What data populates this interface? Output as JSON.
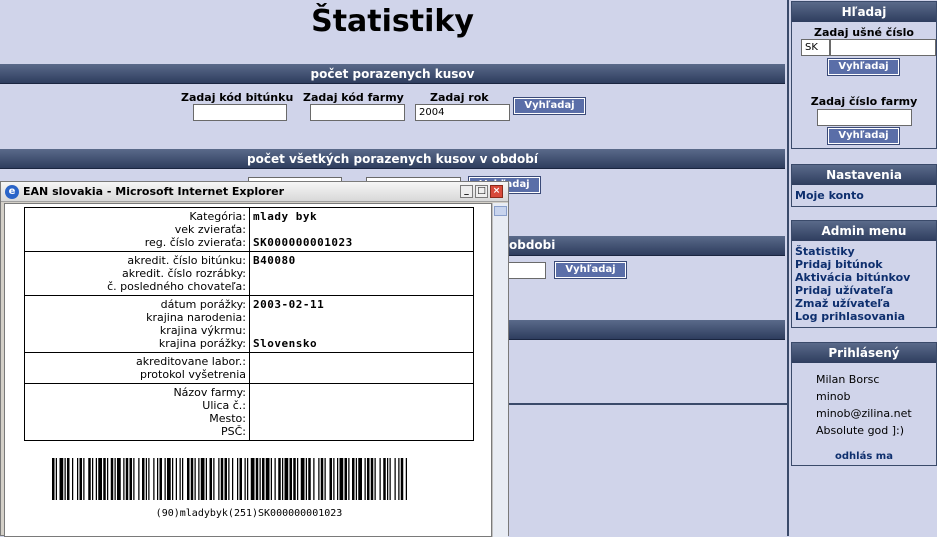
{
  "main": {
    "title": "Štatistiky",
    "section1": {
      "header": "počet porazenych kusov",
      "label_bitunok": "Zadaj kód bitúnku",
      "label_farma": "Zadaj kód farmy",
      "label_rok": "Zadaj rok",
      "rok_value": "2004",
      "button": "Vyhľadaj"
    },
    "section2": {
      "header": "počet všetkých porazenych kusov v období",
      "button": "Vyhľadaj"
    },
    "section3": {
      "header_tail": "obdobi",
      "button": "Vyhľadaj"
    }
  },
  "sidebar": {
    "search": {
      "header": "Hľadaj",
      "ear_label": "Zadaj ušné číslo",
      "ear_prefix": "SK",
      "ear_button": "Vyhľadaj",
      "farm_label": "Zadaj číslo farmy",
      "farm_button": "Vyhľadaj"
    },
    "settings": {
      "header": "Nastavenia",
      "items": [
        "Moje konto"
      ]
    },
    "admin": {
      "header": "Admin menu",
      "items": [
        "Štatistiky",
        "Pridaj bitúnok",
        "Aktivácia bitúnkov",
        "Pridaj užívateľa",
        "Zmaž užívateľa",
        "Log prihlasovania"
      ]
    },
    "user": {
      "header": "Prihlásený",
      "name": "Milan Borsc",
      "login": "minob",
      "email": "minob@zilina.net",
      "role": "Absolute god ]:)",
      "logout": "odhlás ma"
    }
  },
  "popup": {
    "title": "EAN slovakia - Microsoft Internet Explorer",
    "rows": [
      {
        "keys": [
          "Kategória:",
          "vek zvieraťa:",
          "reg. číslo zvieraťa:"
        ],
        "values": [
          "mlady byk",
          "",
          "SK000000001023"
        ]
      },
      {
        "keys": [
          "akredit. číslo bitúnku:",
          "akredit. číslo rozrábky:",
          "č. posledného chovateľa:"
        ],
        "values": [
          "B40080",
          "",
          ""
        ]
      },
      {
        "keys": [
          "dátum porážky:",
          "krajina narodenia:",
          "krajina výkrmu:",
          "krajina porážky:"
        ],
        "values": [
          "2003-02-11",
          "",
          "",
          "Slovensko"
        ]
      },
      {
        "keys": [
          "akreditovane labor.:",
          "protokol vyšetrenia"
        ],
        "values": [
          "",
          ""
        ]
      },
      {
        "keys": [
          "Názov farmy:",
          "Ulica č.:",
          "Mesto:",
          "PSČ:"
        ],
        "values": [
          "",
          "",
          "",
          ""
        ]
      }
    ],
    "barcode_text": "(90)mladybyk(251)SK000000001023"
  },
  "colors": {
    "page_bg": "#d0d4ea",
    "bar_bg": "#2e3d5e",
    "button_bg": "#5a6ea8",
    "link": "#0e2f6e"
  }
}
